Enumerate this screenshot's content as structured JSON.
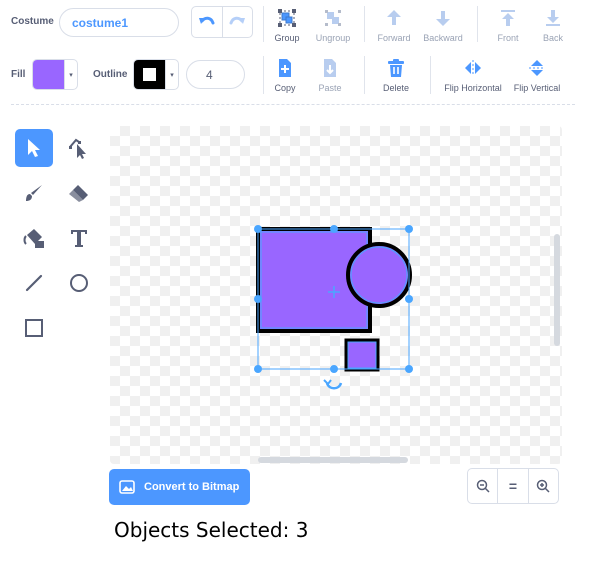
{
  "costume": {
    "label": "Costume",
    "name_value": "costume1"
  },
  "toolbar": {
    "group": "Group",
    "ungroup": "Ungroup",
    "forward": "Forward",
    "backward": "Backward",
    "front": "Front",
    "back": "Back",
    "copy": "Copy",
    "paste": "Paste",
    "delete": "Delete",
    "flip_horizontal": "Flip Horizontal",
    "flip_vertical": "Flip Vertical"
  },
  "style": {
    "fill_label": "Fill",
    "fill_color": "#9966ff",
    "outline_label": "Outline",
    "outline_color": "#000000",
    "outline_width": "4"
  },
  "tools": [
    "select",
    "reshape",
    "brush",
    "eraser",
    "fill",
    "text",
    "line",
    "circle",
    "rectangle"
  ],
  "selected_tool": "select",
  "canvas": {
    "shapes": [
      {
        "type": "rectangle",
        "fill": "#9966ff",
        "stroke": "#000000"
      },
      {
        "type": "circle",
        "fill": "#9966ff",
        "stroke": "#000000"
      },
      {
        "type": "rectangle",
        "fill": "#9966ff",
        "stroke": "#000000"
      }
    ]
  },
  "convert_button": "Convert to Bitmap",
  "zoom": {
    "out": "zoom-out",
    "reset": "=",
    "in": "zoom-in"
  },
  "status": "Objects Selected: 3",
  "colors": {
    "accent": "#4c97ff",
    "selection": "#4aa6ff"
  }
}
